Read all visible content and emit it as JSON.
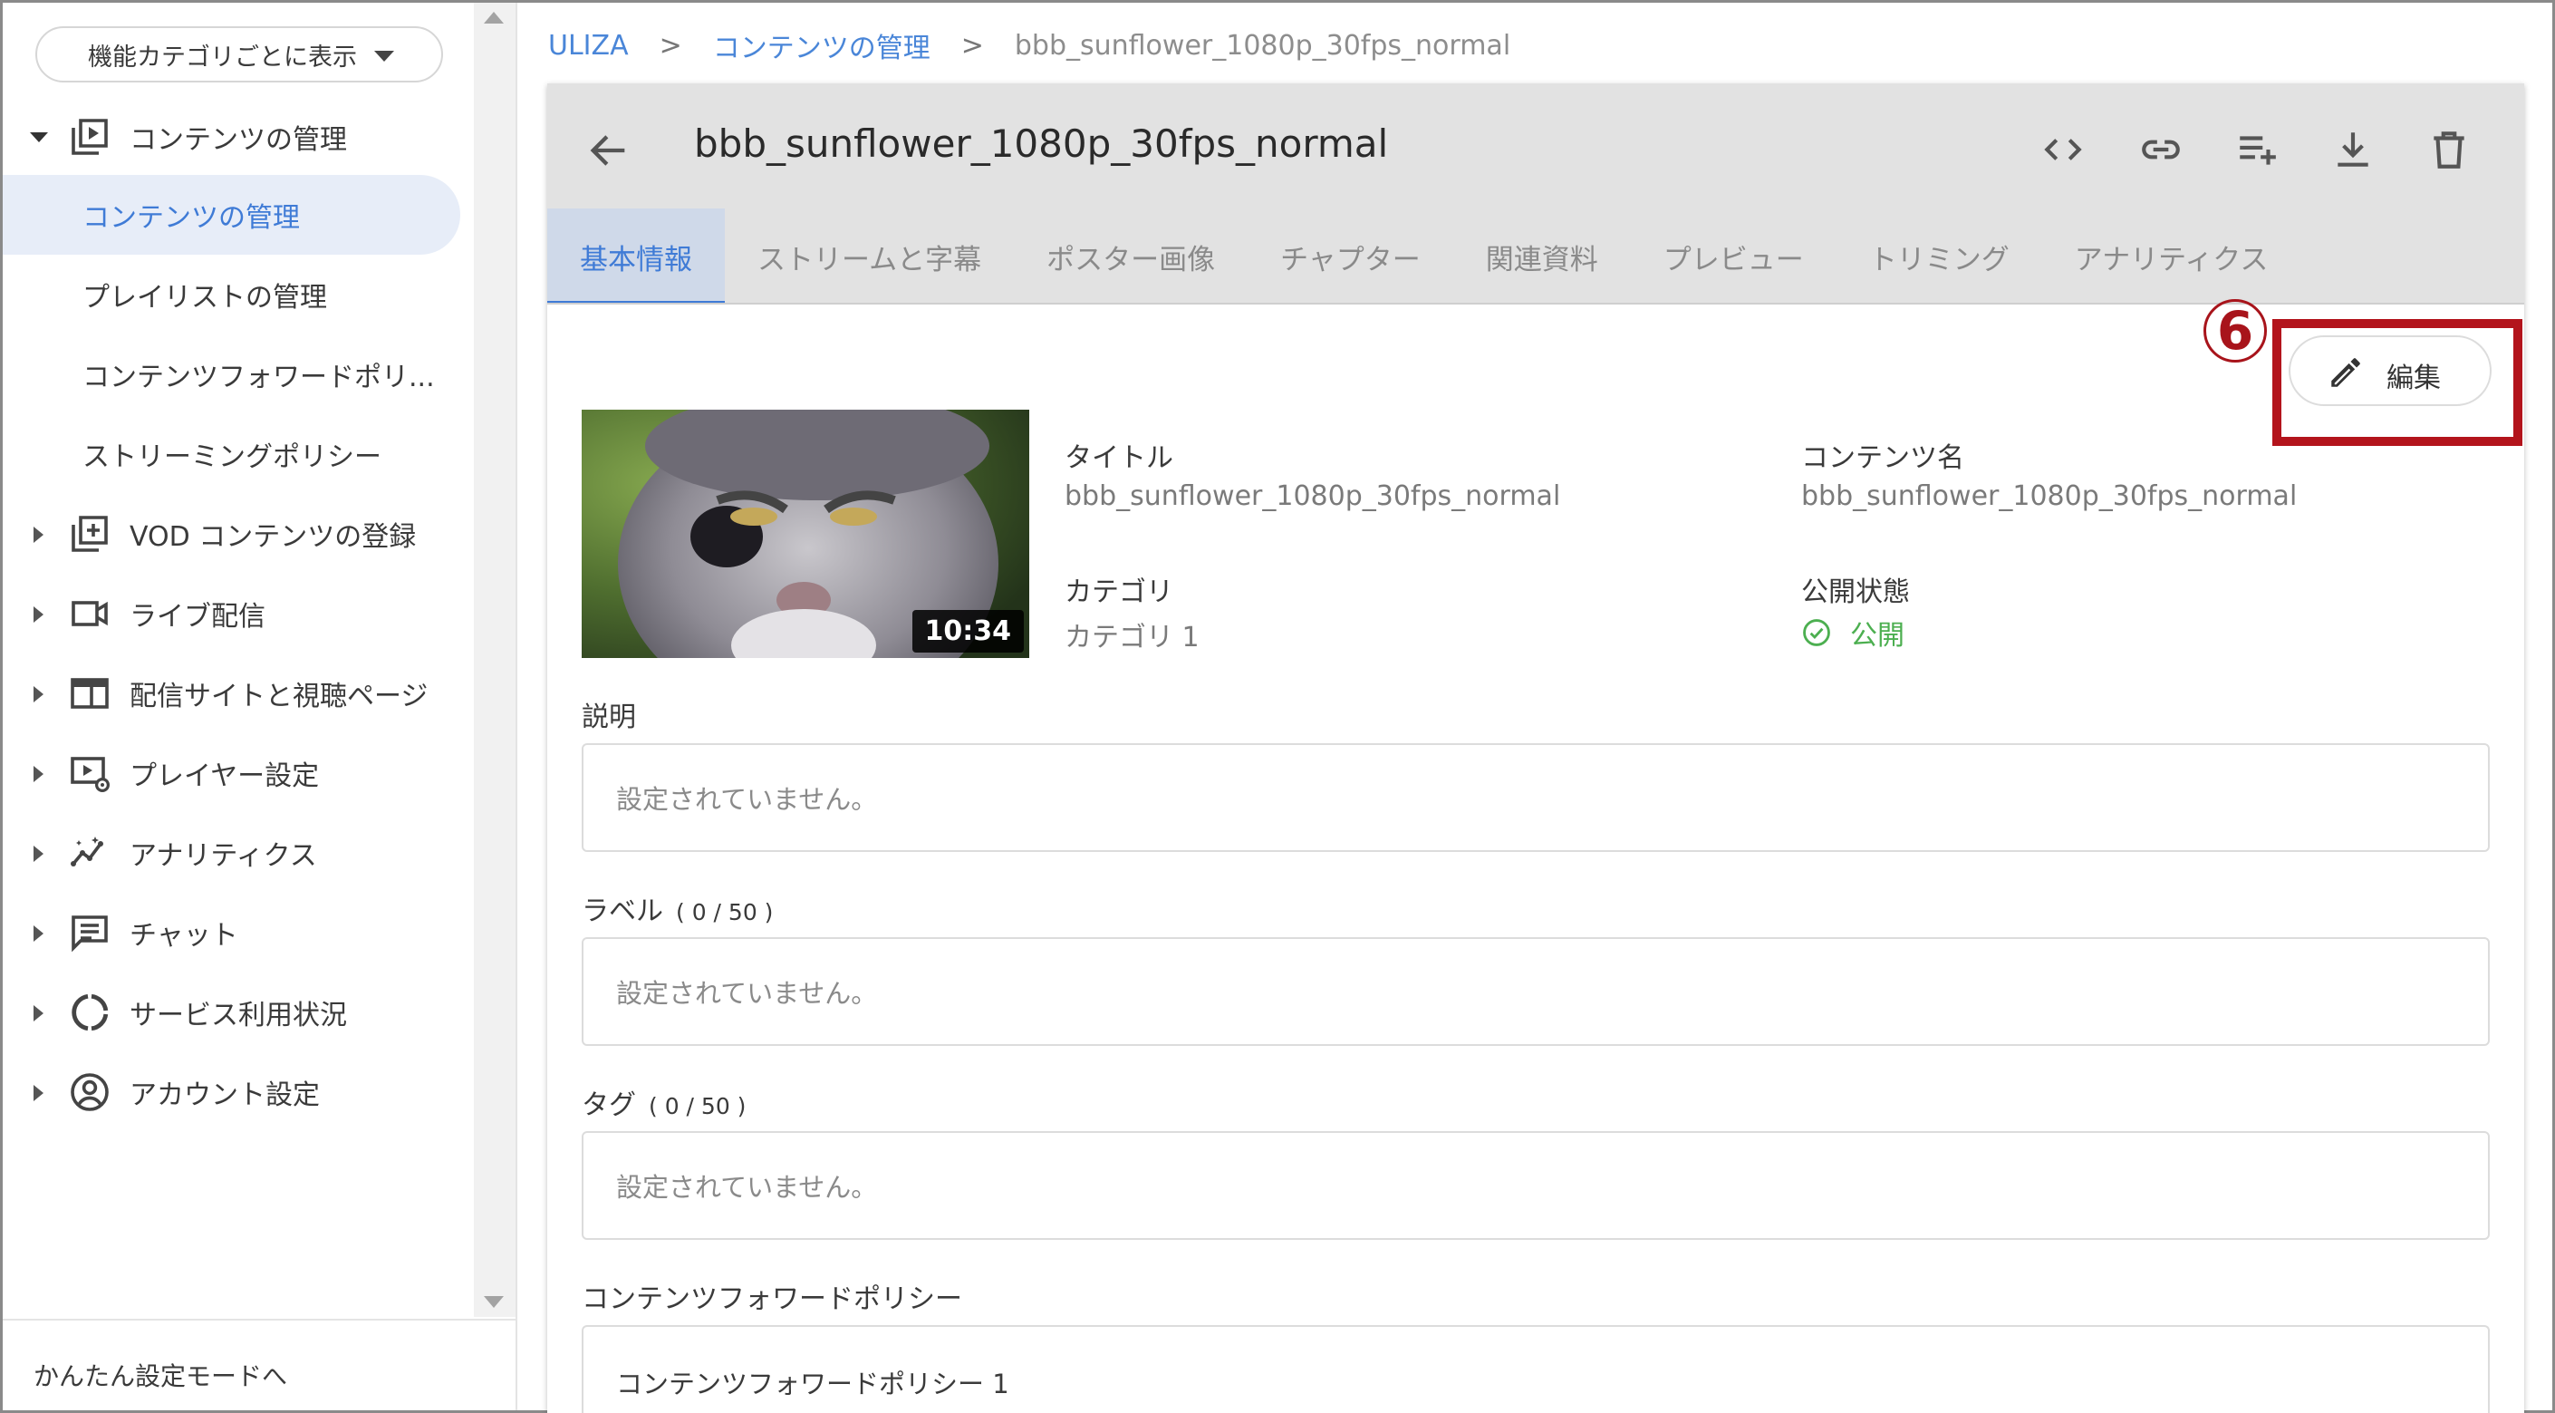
{
  "sidebar": {
    "view_select": "機能カテゴリごとに表示",
    "group_content": "コンテンツの管理",
    "sub_items": [
      {
        "label": "コンテンツの管理",
        "active": true
      },
      {
        "label": "プレイリストの管理",
        "active": false
      },
      {
        "label": "コンテンツフォワードポリ...",
        "active": false
      },
      {
        "label": "ストリーミングポリシー",
        "active": false
      }
    ],
    "items": [
      {
        "label": "VOD コンテンツの登録",
        "icon": "add-library-icon"
      },
      {
        "label": "ライブ配信",
        "icon": "video-camera-icon"
      },
      {
        "label": "配信サイトと視聴ページ",
        "icon": "web-layout-icon"
      },
      {
        "label": "プレイヤー設定",
        "icon": "player-settings-icon"
      },
      {
        "label": "アナリティクス",
        "icon": "insights-icon"
      },
      {
        "label": "チャット",
        "icon": "chat-icon"
      },
      {
        "label": "サービス利用状況",
        "icon": "donut-chart-icon"
      },
      {
        "label": "アカウント設定",
        "icon": "account-circle-icon"
      }
    ],
    "footer": "かんたん設定モードへ"
  },
  "breadcrumb": {
    "root": "ULIZA",
    "section": "コンテンツの管理",
    "current": "bbb_sunflower_1080p_30fps_normal",
    "separator": ">"
  },
  "content": {
    "title": "bbb_sunflower_1080p_30fps_normal",
    "header_icons": [
      "code-icon",
      "link-icon",
      "playlist-add-icon",
      "download-icon",
      "delete-icon"
    ],
    "tabs": [
      {
        "label": "基本情報",
        "active": true
      },
      {
        "label": "ストリームと字幕",
        "active": false
      },
      {
        "label": "ポスター画像",
        "active": false
      },
      {
        "label": "チャプター",
        "active": false
      },
      {
        "label": "関連資料",
        "active": false
      },
      {
        "label": "プレビュー",
        "active": false
      },
      {
        "label": "トリミング",
        "active": false
      },
      {
        "label": "アナリティクス",
        "active": false
      }
    ],
    "edit_label": "編集",
    "step_marker": "6",
    "thumbnail": {
      "duration": "10:34"
    },
    "fields": {
      "title_label": "タイトル",
      "title_value": "bbb_sunflower_1080p_30fps_normal",
      "content_name_label": "コンテンツ名",
      "content_name_value": "bbb_sunflower_1080p_30fps_normal",
      "category_label": "カテゴリ",
      "category_value": "カテゴリ 1",
      "status_label": "公開状態",
      "status_value": "公開"
    },
    "description": {
      "label": "説明",
      "value": "設定されていません。"
    },
    "labels": {
      "label": "ラベル",
      "counter": "( 0 / 50 )",
      "value": "設定されていません。"
    },
    "tags": {
      "label": "タグ",
      "counter": "( 0 / 50 )",
      "value": "設定されていません。"
    },
    "forward_policy": {
      "label": "コンテンツフォワードポリシー",
      "value": "コンテンツフォワードポリシー 1"
    }
  },
  "colors": {
    "accent": "#3f7bd6",
    "active_bg": "#e7edf8",
    "status_green": "#4caf50",
    "highlight_red": "#b3141c"
  }
}
